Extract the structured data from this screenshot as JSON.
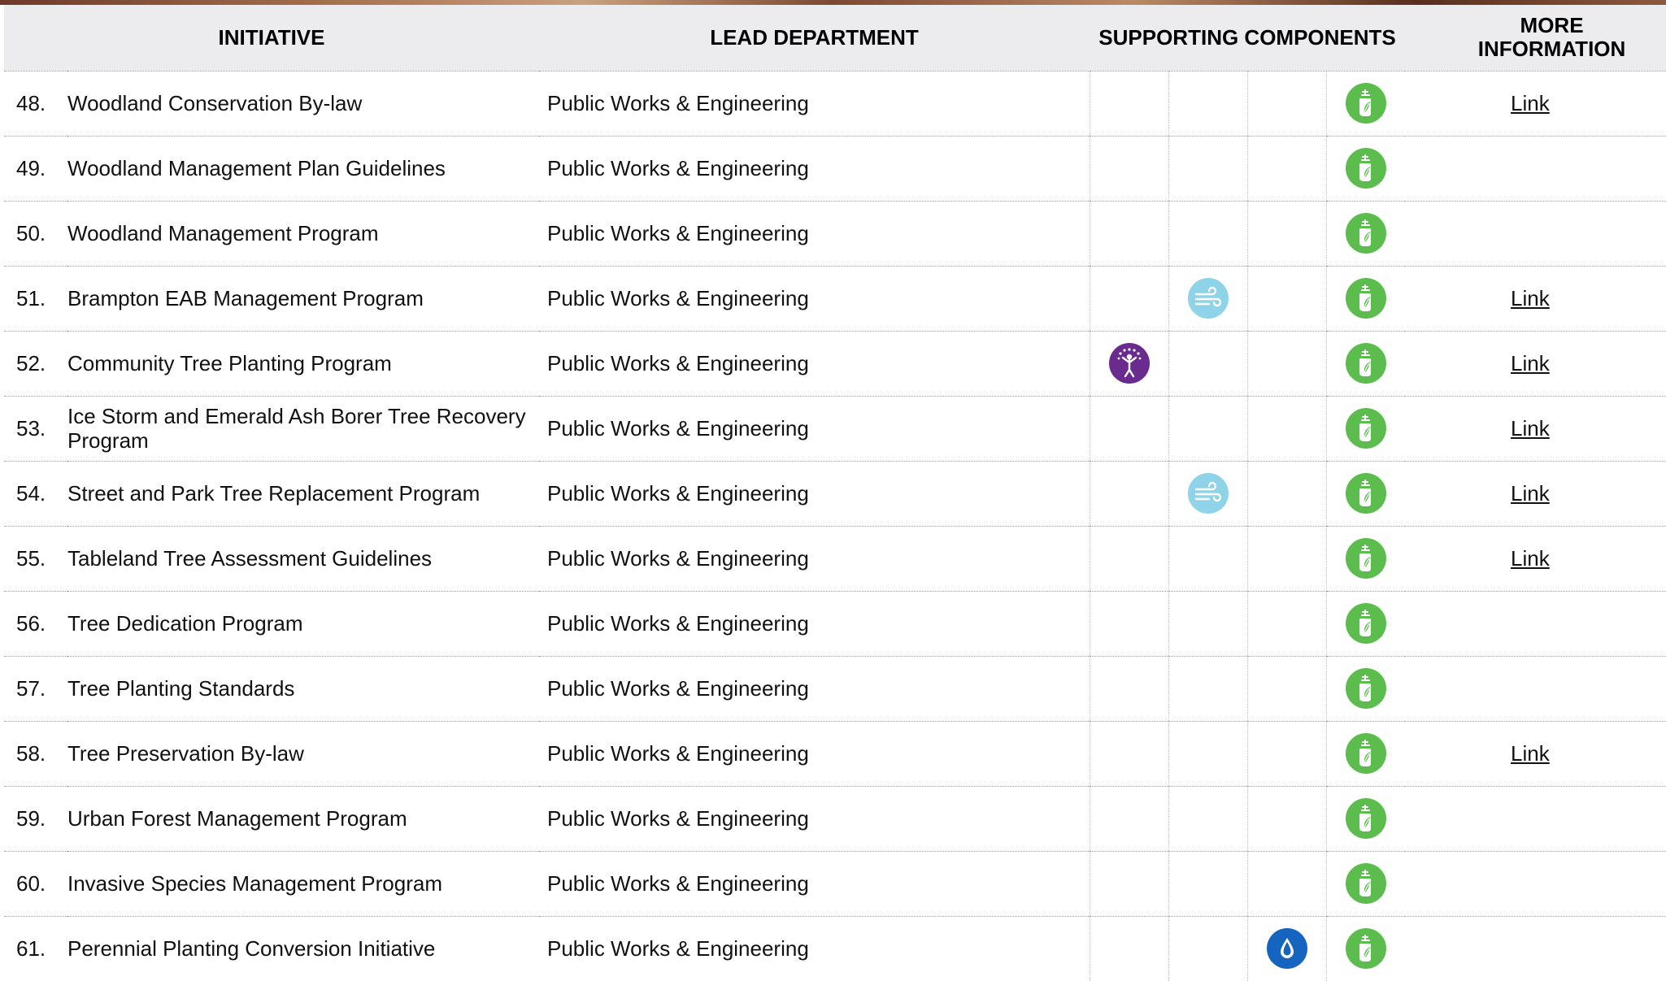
{
  "header": {
    "initiative": "INITIATIVE",
    "lead_department": "LEAD DEPARTMENT",
    "supporting_components": "SUPPORTING COMPONENTS",
    "more_information_line1": "MORE",
    "more_information_line2": "INFORMATION"
  },
  "icons": {
    "community-icon": {
      "color": "#6a2a8e"
    },
    "air-icon": {
      "color": "#8fd3e8"
    },
    "water-icon": {
      "color": "#1565c0"
    },
    "forest-icon": {
      "color": "#5cbd4e"
    }
  },
  "rows": [
    {
      "num": "48.",
      "initiative": "Woodland Conservation By-law",
      "dept": "Public Works & Engineering",
      "community": false,
      "air": false,
      "water": false,
      "forest": true,
      "link": "Link"
    },
    {
      "num": "49.",
      "initiative": "Woodland Management Plan Guidelines",
      "dept": "Public Works & Engineering",
      "community": false,
      "air": false,
      "water": false,
      "forest": true,
      "link": ""
    },
    {
      "num": "50.",
      "initiative": "Woodland Management Program",
      "dept": "Public Works & Engineering",
      "community": false,
      "air": false,
      "water": false,
      "forest": true,
      "link": ""
    },
    {
      "num": "51.",
      "initiative": "Brampton EAB Management Program",
      "dept": "Public Works & Engineering",
      "community": false,
      "air": true,
      "water": false,
      "forest": true,
      "link": "Link"
    },
    {
      "num": "52.",
      "initiative": "Community Tree Planting Program",
      "dept": "Public Works & Engineering",
      "community": true,
      "air": false,
      "water": false,
      "forest": true,
      "link": "Link"
    },
    {
      "num": "53.",
      "initiative": "Ice Storm and Emerald Ash Borer Tree Recovery Program",
      "dept": "Public Works & Engineering",
      "community": false,
      "air": false,
      "water": false,
      "forest": true,
      "link": "Link"
    },
    {
      "num": "54.",
      "initiative": "Street and Park Tree Replacement Program",
      "dept": "Public Works & Engineering",
      "community": false,
      "air": true,
      "water": false,
      "forest": true,
      "link": "Link"
    },
    {
      "num": "55.",
      "initiative": "Tableland Tree Assessment Guidelines",
      "dept": "Public Works & Engineering",
      "community": false,
      "air": false,
      "water": false,
      "forest": true,
      "link": "Link"
    },
    {
      "num": "56.",
      "initiative": "Tree Dedication Program",
      "dept": "Public Works & Engineering",
      "community": false,
      "air": false,
      "water": false,
      "forest": true,
      "link": ""
    },
    {
      "num": "57.",
      "initiative": "Tree Planting Standards",
      "dept": "Public Works & Engineering",
      "community": false,
      "air": false,
      "water": false,
      "forest": true,
      "link": ""
    },
    {
      "num": "58.",
      "initiative": "Tree Preservation By-law",
      "dept": "Public Works & Engineering",
      "community": false,
      "air": false,
      "water": false,
      "forest": true,
      "link": "Link"
    },
    {
      "num": "59.",
      "initiative": "Urban Forest Management Program",
      "dept": "Public Works & Engineering",
      "community": false,
      "air": false,
      "water": false,
      "forest": true,
      "link": ""
    },
    {
      "num": "60.",
      "initiative": "Invasive Species Management Program",
      "dept": "Public Works & Engineering",
      "community": false,
      "air": false,
      "water": false,
      "forest": true,
      "link": ""
    },
    {
      "num": "61.",
      "initiative": "Perennial Planting Conversion Initiative",
      "dept": "Public Works & Engineering",
      "community": false,
      "air": false,
      "water": true,
      "forest": true,
      "link": ""
    }
  ]
}
